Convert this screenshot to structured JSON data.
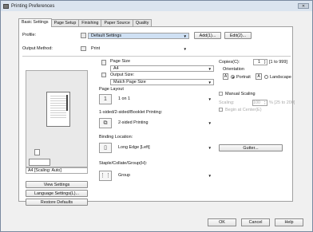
{
  "window": {
    "title": "Printing Preferences"
  },
  "tabs": [
    "Basic Settings",
    "Page Setup",
    "Finishing",
    "Paper Source",
    "Quality"
  ],
  "profile": {
    "label": "Profile:",
    "value": "Default Settings",
    "add": "Add(1)...",
    "edit": "Edit(2)..."
  },
  "output_method": {
    "label": "Output Method:",
    "value": "Print"
  },
  "preview": {
    "caption": "A4 [Scaling: Auto]"
  },
  "left_buttons": {
    "view": "View Settings",
    "language": "Language Settings(L)...",
    "restore": "Restore Defaults"
  },
  "page_size": {
    "label": "Page Size",
    "value": "A4"
  },
  "output_size": {
    "label": "Output Size:",
    "value": "Match Page Size"
  },
  "page_layout": {
    "label": "Page Layout",
    "value": "1 on 1",
    "icon_text": "1"
  },
  "sided": {
    "label": "1-sided/2-sided/Booklet Printing:",
    "value": "2-sided Printing"
  },
  "binding": {
    "label": "Binding Location:",
    "value": "Long Edge [Left]"
  },
  "staple": {
    "label": "Staple/Collate/Group(H):",
    "value": "Group"
  },
  "copies": {
    "label": "Copies(C):",
    "value": "1",
    "range": "[1 to 999]"
  },
  "orientation": {
    "label": "Orientation",
    "portrait": "Portrait",
    "landscape": "Landscape",
    "selected": "portrait"
  },
  "manual_scaling": {
    "label": "Manual Scaling"
  },
  "scaling": {
    "label": "Scaling:",
    "value": "100",
    "range": "% [25 to 200]"
  },
  "begin_center": {
    "label": "Begin at Center(E)"
  },
  "gutter": {
    "label": "Gutter..."
  },
  "footer": {
    "ok": "OK",
    "cancel": "Cancel",
    "help": "Help"
  },
  "colors": {
    "titlebar": "#dbe4ef",
    "panel": "#ffffff",
    "chrome": "#f0f0f0"
  }
}
